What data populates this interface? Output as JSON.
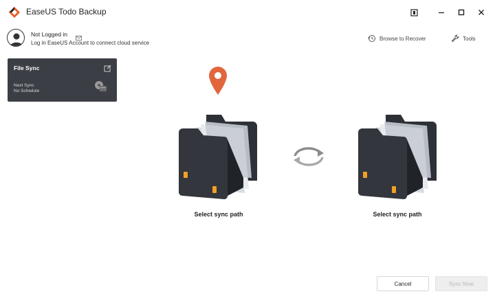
{
  "app": {
    "title": "EaseUS Todo Backup",
    "brand_color": "#e85d25"
  },
  "account": {
    "status": "Not Logged in",
    "hint": "Log in EaseUS Account to connect cloud service"
  },
  "toolbar": {
    "browse_to_recover": "Browse to Recover",
    "tools": "Tools"
  },
  "task": {
    "title": "File Sync",
    "next_sync": "Next Sync",
    "schedule": "No Schedule"
  },
  "sync": {
    "source_label": "Select sync path",
    "target_label": "Select sync path",
    "pin_color": "#e2663c",
    "folder_color": "#33363d",
    "tab_color": "#f2a024"
  },
  "footer": {
    "cancel": "Cancel",
    "sync_now": "Sync Now"
  }
}
